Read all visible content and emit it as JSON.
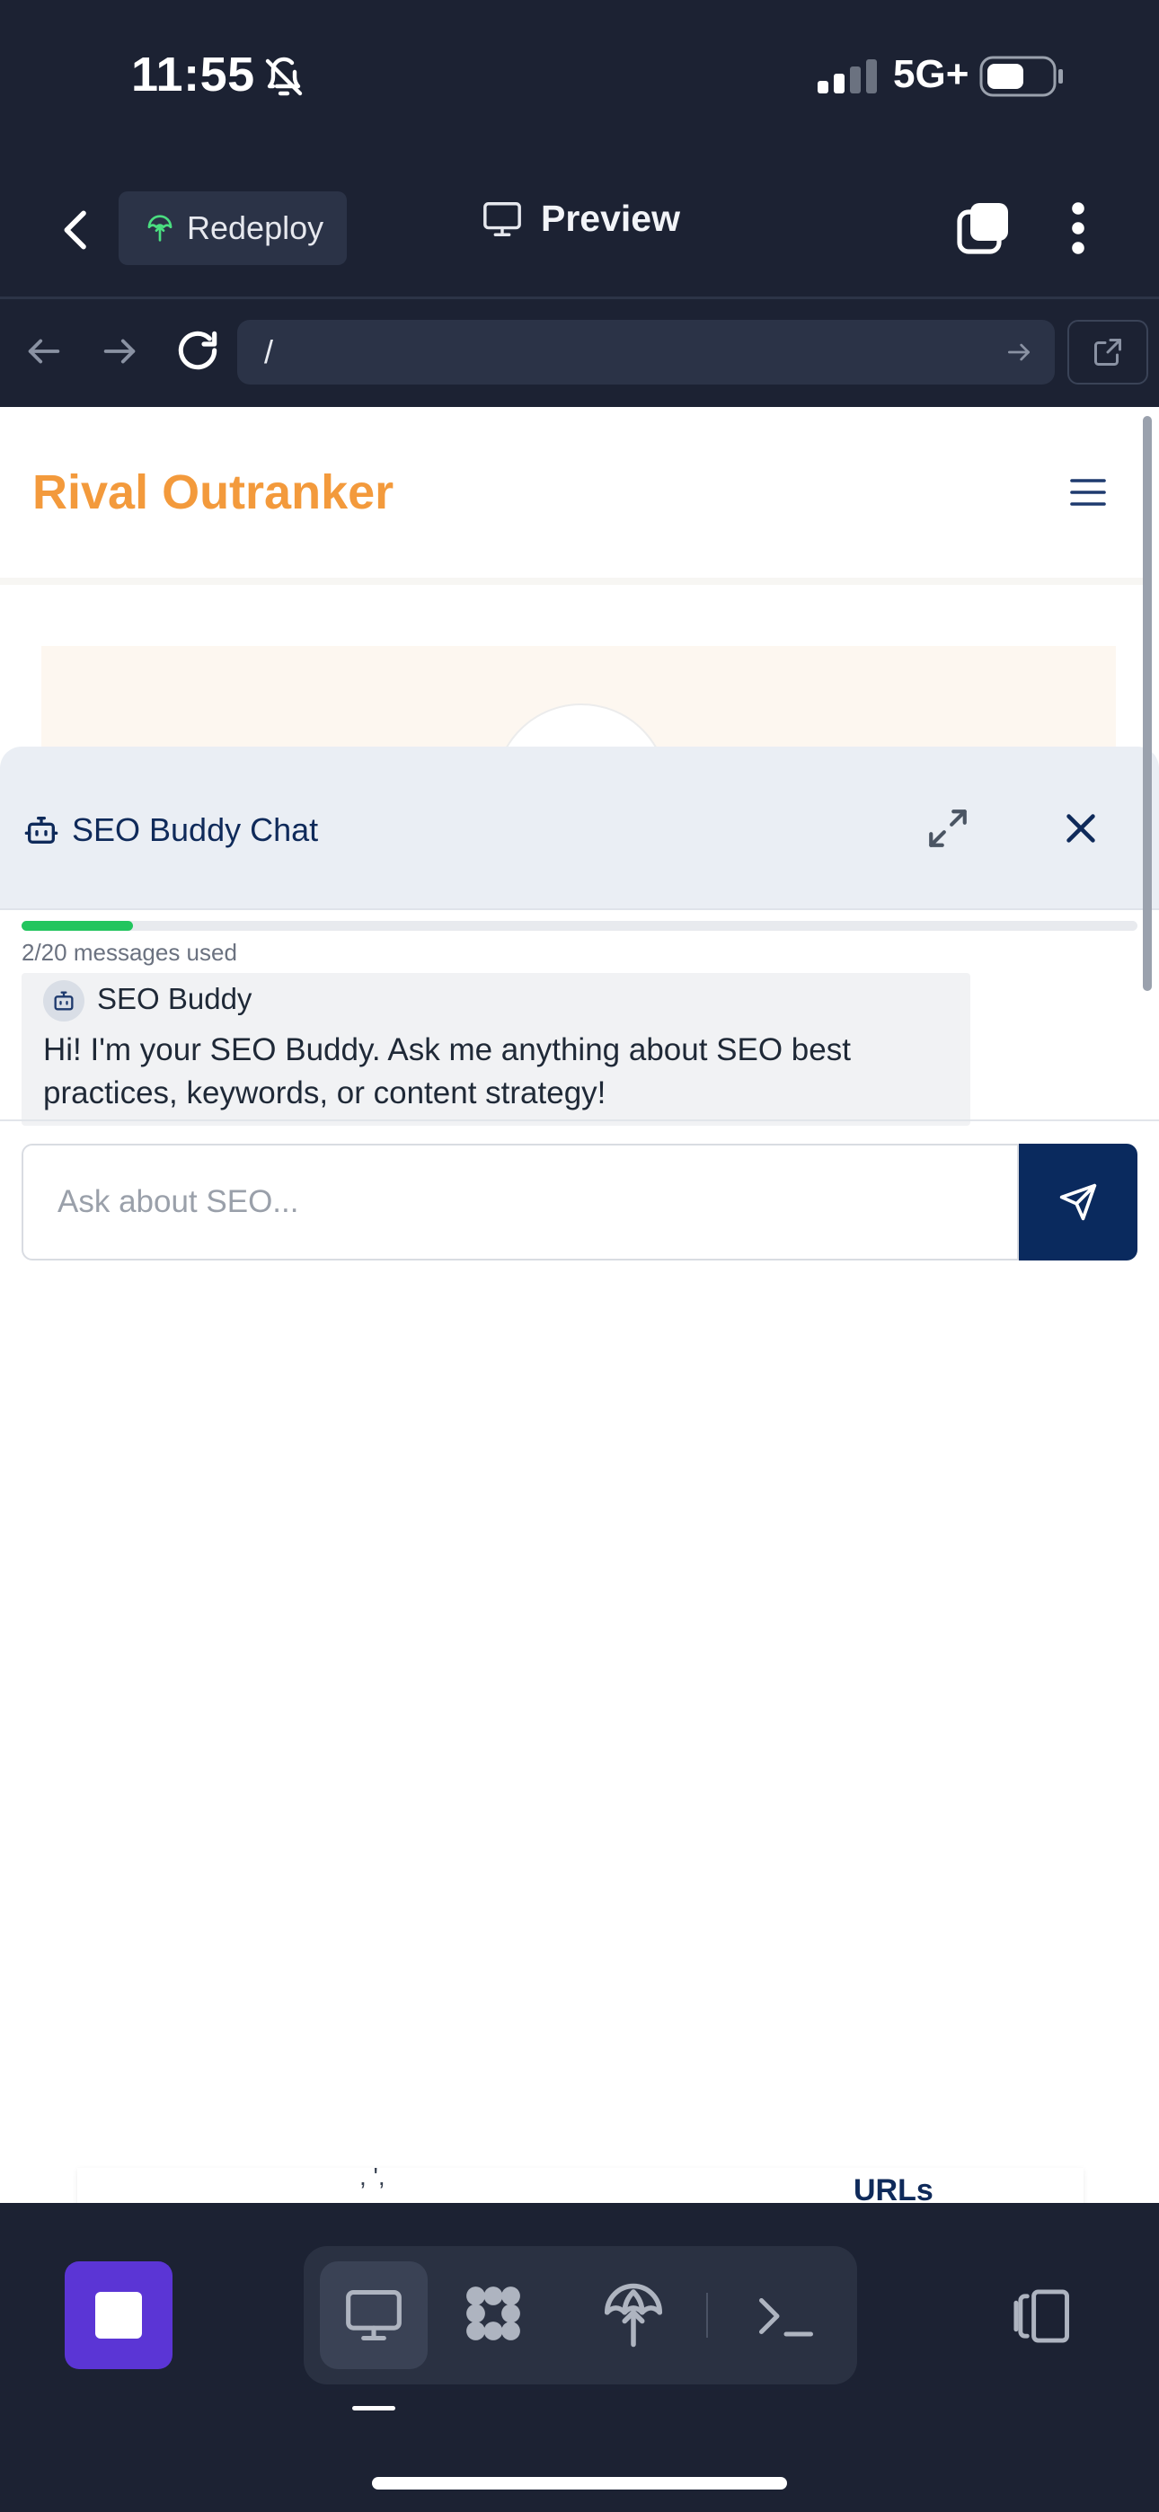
{
  "status_bar": {
    "time": "11:55",
    "network": "5G+"
  },
  "app_bar": {
    "redeploy_label": "Redeploy",
    "preview_label": "Preview"
  },
  "url_bar": {
    "url": "/"
  },
  "site": {
    "logo": "Rival Outranker",
    "brand_color": "#f39a3c"
  },
  "chat": {
    "title": "SEO Buddy Chat",
    "usage_text": "2/20 messages used",
    "messages_used": 2,
    "messages_limit": 20,
    "messages": [
      {
        "author": "SEO Buddy",
        "text": "Hi! I'm your SEO Buddy. Ask me anything about SEO best practices, keywords, or content strategy!"
      }
    ],
    "input_placeholder": "Ask about SEO...",
    "input_value": "",
    "accent_color": "#0a2a5e",
    "progress_color": "#22c55e"
  },
  "background_page": {
    "fragment": ", ',",
    "urls_label": "URLs"
  },
  "bottom_toolbar": {
    "stop_color": "#5b35d5",
    "tools": [
      "desktop-icon",
      "grid-icon",
      "deploy-icon",
      "terminal-icon"
    ],
    "device_toggle": "device-toggle-icon"
  }
}
